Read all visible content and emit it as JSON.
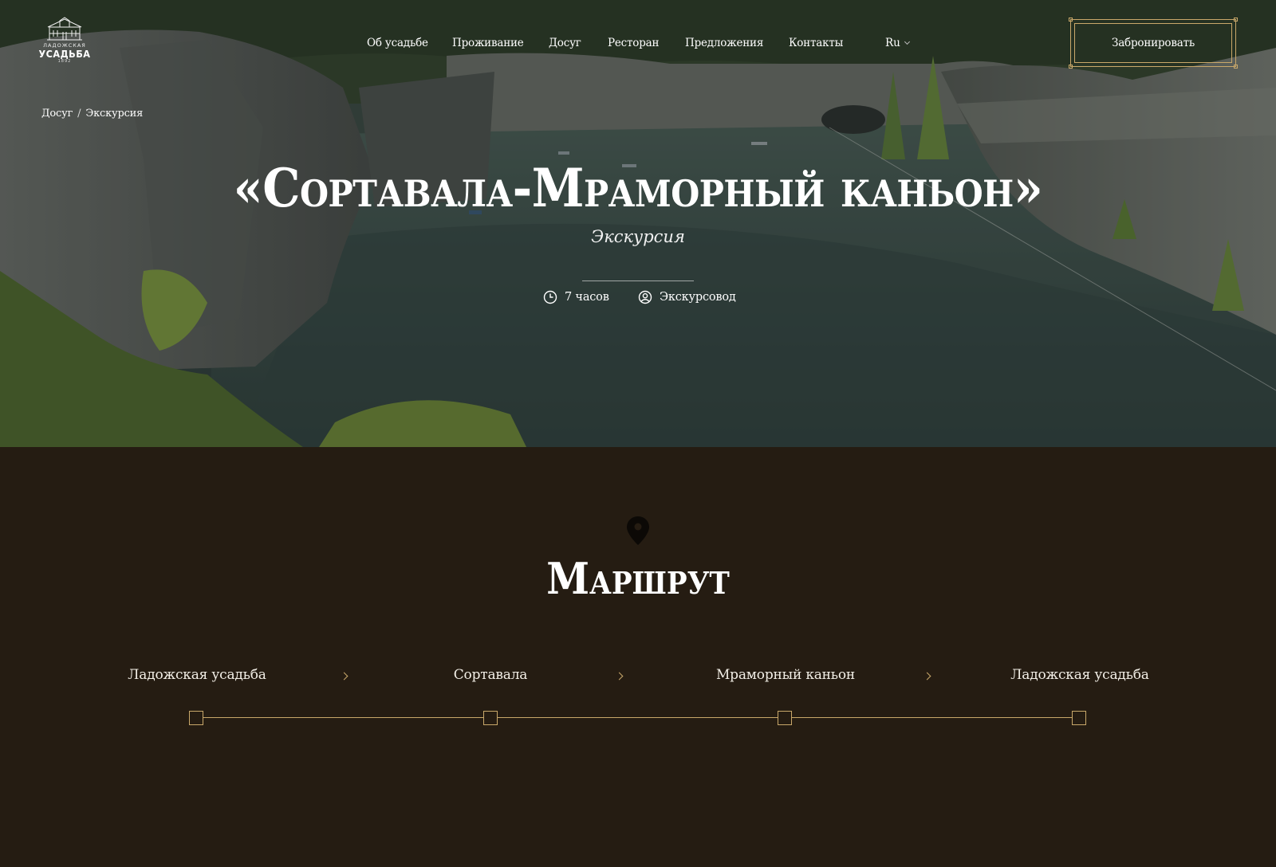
{
  "brand": {
    "logo_top": "ЛАДОЖСКАЯ",
    "logo_main": "УСАДЬБА",
    "logo_year": "1892"
  },
  "nav": {
    "items": [
      {
        "label": "Об усадьбе"
      },
      {
        "label": "Проживание"
      },
      {
        "label": "Досуг"
      },
      {
        "label": "Ресторан"
      },
      {
        "label": "Предложения"
      },
      {
        "label": "Контакты"
      }
    ],
    "language": "Ru",
    "book_label": "Забронировать"
  },
  "breadcrumb": {
    "items": [
      "Досуг",
      "Экскурсия"
    ],
    "separator": "/"
  },
  "hero": {
    "title": "«Сортавала-Мраморный каньон»",
    "subtitle": "Экскурсия",
    "duration": "7 часов",
    "guide": "Экскурсовод",
    "duration_icon": "clock-icon",
    "guide_icon": "user-circle-icon"
  },
  "route": {
    "icon": "map-pin-icon",
    "title": "Маршрут",
    "stops": [
      "Ладожская усадьба",
      "Сортавала",
      "Мраморный каньон",
      "Ладожская усадьба"
    ]
  },
  "colors": {
    "background_dark": "#251c12",
    "accent_gold": "#c9a86a",
    "text": "#ffffff"
  }
}
